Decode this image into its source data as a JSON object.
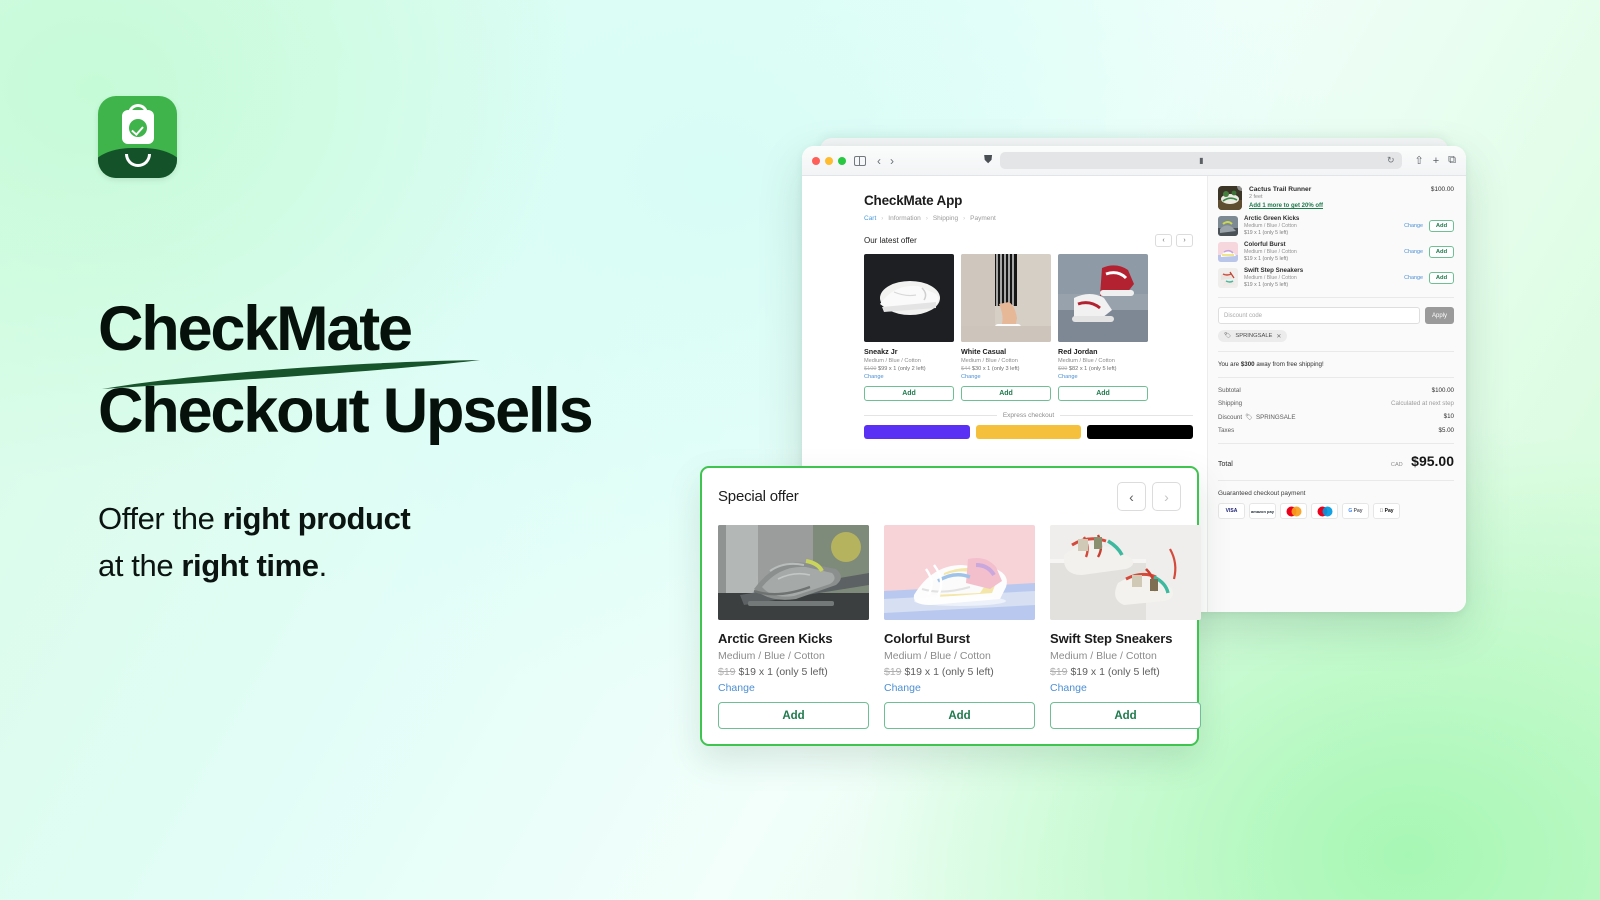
{
  "brand": {
    "logo_icon": "shopping-bag-check-icon",
    "accent_green": "#3eb44a",
    "dark_green": "#14532a"
  },
  "hero": {
    "headline_line1": "CheckMate",
    "headline_line2": "Checkout Upsells",
    "sub_part1": "Offer the ",
    "sub_bold1": "right product",
    "sub_part2": "at the ",
    "sub_bold2": "right time",
    "sub_part3": "."
  },
  "browser": {
    "traffic_lights": [
      "close",
      "minimize",
      "zoom"
    ],
    "icons": {
      "sidebar": "sidebar-icon",
      "back": "‹",
      "forward": "›",
      "shield": "⛊",
      "lock": "▮",
      "reload": "↻",
      "share": "⇧",
      "new_tab": "+",
      "tabs": "⧉"
    }
  },
  "app": {
    "title": "CheckMate App",
    "breadcrumbs": [
      {
        "label": "Cart",
        "active": true
      },
      {
        "label": "Information",
        "active": false
      },
      {
        "label": "Shipping",
        "active": false
      },
      {
        "label": "Payment",
        "active": false
      }
    ],
    "offer_label": "Our latest offer",
    "nav_prev": "‹",
    "nav_next": "›",
    "products": [
      {
        "name": "Sneakz Jr",
        "variant": "Medium / Blue / Cotton",
        "old_price": "$109",
        "price": "$99",
        "qty": "x 1",
        "stock": "(only 2 left)",
        "change": "Change",
        "add": "Add"
      },
      {
        "name": "White Casual",
        "variant": "Medium / Blue / Cotton",
        "old_price": "$44",
        "price": "$30",
        "qty": "x 1",
        "stock": "(only 3 left)",
        "change": "Change",
        "add": "Add"
      },
      {
        "name": "Red Jordan",
        "variant": "Medium / Blue / Cotton",
        "old_price": "$99",
        "price": "$82",
        "qty": "x 1",
        "stock": "(only 5 left)",
        "change": "Change",
        "add": "Add"
      }
    ],
    "express_checkout_label": "Express checkout",
    "express_buttons": [
      "shop-pay",
      "paypal",
      "apple-pay"
    ]
  },
  "cart": {
    "hero_item": {
      "name": "Cactus Trail Runner",
      "sub": "2 feet",
      "promo": "Add 1 more to get 20% off",
      "price": "$100.00",
      "qty_badge": "1"
    },
    "items": [
      {
        "name": "Arctic Green Kicks",
        "variant": "Medium / Blue / Cotton",
        "price": "$19  x 1  (only 5 left)",
        "change": "Change",
        "add": "Add"
      },
      {
        "name": "Colorful Burst",
        "variant": "Medium / Blue / Cotton",
        "price": "$19  x 1  (only 5 left)",
        "change": "Change",
        "add": "Add"
      },
      {
        "name": "Swift Step Sneakers",
        "variant": "Medium / Blue / Cotton",
        "price": "$19  x 1  (only 5 left)",
        "change": "Change",
        "add": "Add"
      }
    ],
    "discount_placeholder": "Discount code",
    "apply_label": "Apply",
    "applied_tag": "SPRINGSALE",
    "tag_remove": "✕",
    "free_shipping_pre": "You are ",
    "free_shipping_amount": "$300",
    "free_shipping_post": " away from free shipping!",
    "summary": [
      {
        "label": "Subtotal",
        "value": "$100.00",
        "muted": false
      },
      {
        "label": "Shipping",
        "value": "Calculated at next step",
        "muted": true
      },
      {
        "label": "Discount",
        "value": "$10",
        "muted": false,
        "tag": "SPRINGSALE"
      },
      {
        "label": "Taxes",
        "value": "$5.00",
        "muted": false
      }
    ],
    "total_label": "Total",
    "total_currency": "CAD",
    "total_value": "$95.00",
    "guarantee_label": "Guaranteed checkout payment",
    "payment_methods": [
      "VISA",
      "amazon pay",
      "mastercard",
      "maestro",
      "G Pay",
      "Apple Pay"
    ]
  },
  "special_offer": {
    "title": "Special offer",
    "nav_prev": "‹",
    "nav_next": "›",
    "products": [
      {
        "name": "Arctic Green Kicks",
        "variant": "Medium / Blue / Cotton",
        "old_price": "$19",
        "price": "$19",
        "qty": "x 1",
        "stock": "(only 5 left)",
        "change": "Change",
        "add": "Add",
        "image": "grey-knit-sneakers-photo"
      },
      {
        "name": "Colorful Burst",
        "variant": "Medium / Blue / Cotton",
        "old_price": "$19",
        "price": "$19",
        "qty": "x 1",
        "stock": "(only 5 left)",
        "change": "Change",
        "add": "Add",
        "image": "pastel-sneakers-photo"
      },
      {
        "name": "Swift Step Sneakers",
        "variant": "Medium / Blue / Cotton",
        "old_price": "$19",
        "price": "$19",
        "qty": "x 1",
        "stock": "(only 5 left)",
        "change": "Change",
        "add": "Add",
        "image": "multicolor-sneakers-photo"
      }
    ]
  }
}
